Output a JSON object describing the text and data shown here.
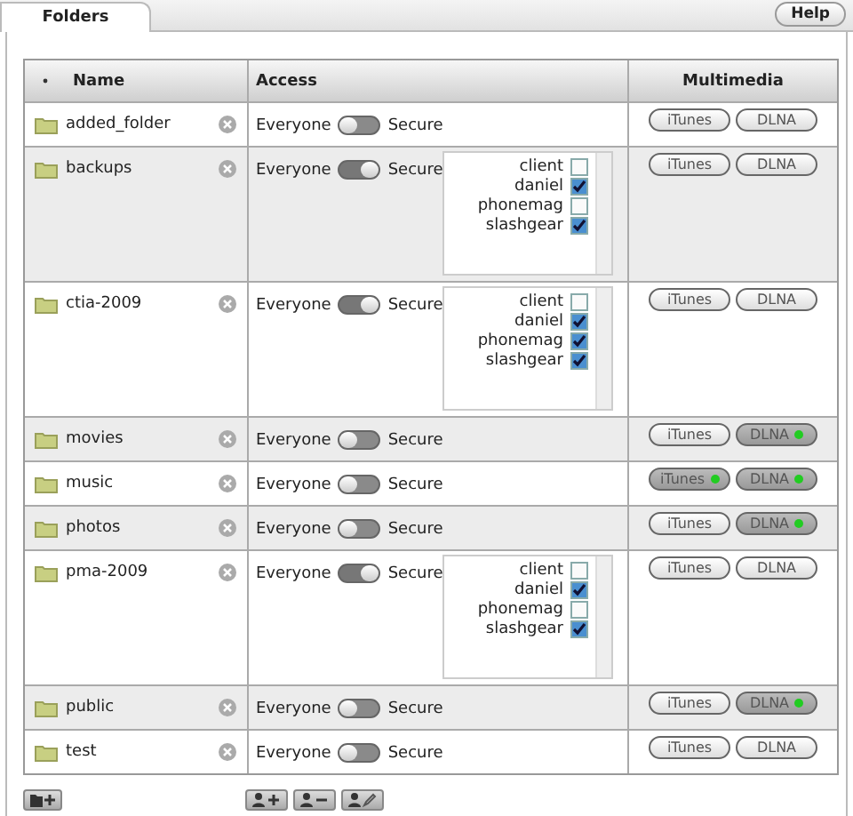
{
  "tabs": [
    {
      "label": "Folders",
      "selected": true
    }
  ],
  "help_button": "Help",
  "table": {
    "columns": [
      "Name",
      "Access",
      "Multimedia"
    ],
    "rows": [
      {
        "name": "added_folder",
        "access": {
          "left": "Everyone",
          "right": "Secure",
          "secure": false
        },
        "media": [
          {
            "label": "iTunes",
            "on": false
          },
          {
            "label": "DLNA",
            "on": false
          }
        ]
      },
      {
        "name": "backups",
        "access": {
          "left": "Everyone",
          "right": "Secure",
          "secure": true
        },
        "users": [
          {
            "name": "client",
            "checked": false
          },
          {
            "name": "daniel",
            "checked": true
          },
          {
            "name": "phonemag",
            "checked": false
          },
          {
            "name": "slashgear",
            "checked": true
          }
        ],
        "media": [
          {
            "label": "iTunes",
            "on": false
          },
          {
            "label": "DLNA",
            "on": false
          }
        ]
      },
      {
        "name": "ctia-2009",
        "access": {
          "left": "Everyone",
          "right": "Secure",
          "secure": true
        },
        "users": [
          {
            "name": "client",
            "checked": false
          },
          {
            "name": "daniel",
            "checked": true
          },
          {
            "name": "phonemag",
            "checked": true
          },
          {
            "name": "slashgear",
            "checked": true
          }
        ],
        "media": [
          {
            "label": "iTunes",
            "on": false
          },
          {
            "label": "DLNA",
            "on": false
          }
        ]
      },
      {
        "name": "movies",
        "access": {
          "left": "Everyone",
          "right": "Secure",
          "secure": false
        },
        "media": [
          {
            "label": "iTunes",
            "on": false
          },
          {
            "label": "DLNA",
            "on": true
          }
        ]
      },
      {
        "name": "music",
        "access": {
          "left": "Everyone",
          "right": "Secure",
          "secure": false
        },
        "media": [
          {
            "label": "iTunes",
            "on": true
          },
          {
            "label": "DLNA",
            "on": true
          }
        ]
      },
      {
        "name": "photos",
        "access": {
          "left": "Everyone",
          "right": "Secure",
          "secure": false
        },
        "media": [
          {
            "label": "iTunes",
            "on": false
          },
          {
            "label": "DLNA",
            "on": true
          }
        ]
      },
      {
        "name": "pma-2009",
        "access": {
          "left": "Everyone",
          "right": "Secure",
          "secure": true
        },
        "users": [
          {
            "name": "client",
            "checked": false
          },
          {
            "name": "daniel",
            "checked": true
          },
          {
            "name": "phonemag",
            "checked": false
          },
          {
            "name": "slashgear",
            "checked": true
          }
        ],
        "media": [
          {
            "label": "iTunes",
            "on": false
          },
          {
            "label": "DLNA",
            "on": false
          }
        ]
      },
      {
        "name": "public",
        "access": {
          "left": "Everyone",
          "right": "Secure",
          "secure": false
        },
        "media": [
          {
            "label": "iTunes",
            "on": false
          },
          {
            "label": "DLNA",
            "on": true
          }
        ]
      },
      {
        "name": "test",
        "access": {
          "left": "Everyone",
          "right": "Secure",
          "secure": false
        },
        "media": [
          {
            "label": "iTunes",
            "on": false
          },
          {
            "label": "DLNA",
            "on": false
          }
        ]
      }
    ]
  }
}
